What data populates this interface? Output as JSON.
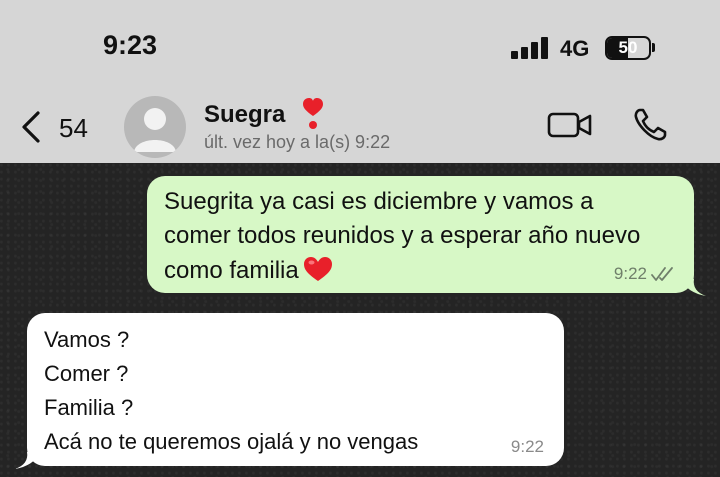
{
  "status_bar": {
    "time": "9:23",
    "network": "4G",
    "battery": "50",
    "battery_level": 0.5
  },
  "header": {
    "back_count": "54",
    "contact_name": "Suegra",
    "last_seen": "últ. vez hoy a la(s) 9:22",
    "icons": {
      "back": "chevron-left-icon",
      "avatar": "person-icon",
      "video": "video-camera-icon",
      "call": "phone-icon",
      "badge": "heart-exclamation-icon"
    }
  },
  "messages": [
    {
      "direction": "outgoing",
      "lines": [
        "Suegrita ya casi es diciembre y vamos a",
        "comer todos reunidos y a esperar año nuevo",
        "como familia"
      ],
      "emoji": "red-heart-icon",
      "time": "9:22",
      "status": "read-double-check-icon"
    },
    {
      "direction": "incoming",
      "lines": [
        "Vamos ?",
        "Comer ?",
        "Familia ?",
        "Acá no te queremos ojalá y no vengas"
      ],
      "time": "9:22"
    }
  ],
  "colors": {
    "header_bg": "#d6d6d6",
    "outgoing_bubble": "#d7f8c6",
    "incoming_bubble": "#ffffff",
    "heart": "#e8202a",
    "chat_bg": "#242424"
  }
}
